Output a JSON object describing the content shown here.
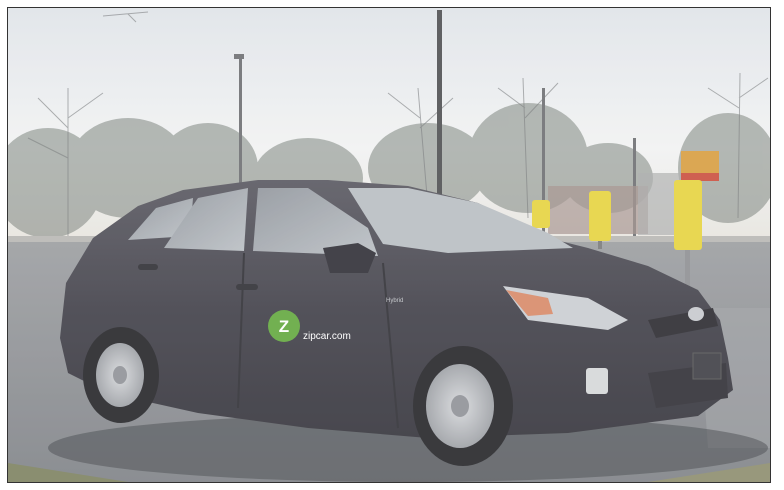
{
  "scene": {
    "logo_letter": "Z",
    "logo_text": "zipcar.com",
    "badge_text": "Hybrid",
    "colors": {
      "sky": "#e9ecef",
      "car_body": "#3e3d46",
      "asphalt": "#84878b",
      "zipcar_green": "#5fa63a",
      "meter_yellow": "#e5d23b"
    }
  }
}
